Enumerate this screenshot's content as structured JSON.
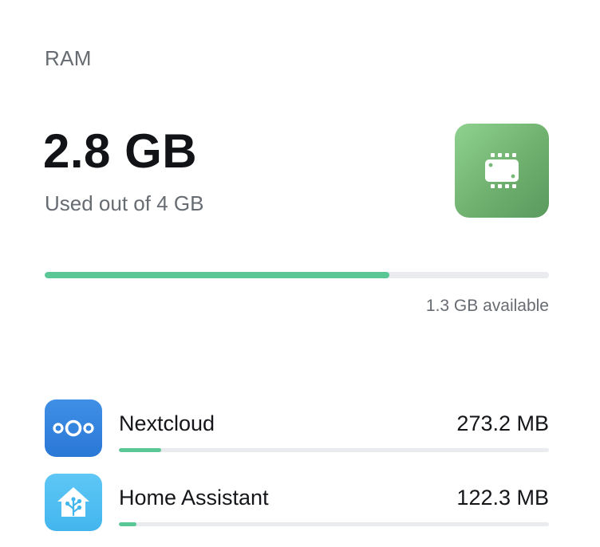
{
  "card": {
    "title": "RAM",
    "used_value": "2.8 GB",
    "used_caption": "Used out of 4 GB",
    "available_text": "1.3 GB available",
    "usage_fraction": 0.683,
    "badge_icon": "ram-chip-icon",
    "accent_color": "#5ac795"
  },
  "apps": [
    {
      "name": "Nextcloud",
      "size": "273.2 MB",
      "icon": "nextcloud-logo-icon",
      "usage_fraction": 0.098
    },
    {
      "name": "Home Assistant",
      "size": "122.3 MB",
      "icon": "home-assistant-logo-icon",
      "usage_fraction": 0.04
    }
  ]
}
